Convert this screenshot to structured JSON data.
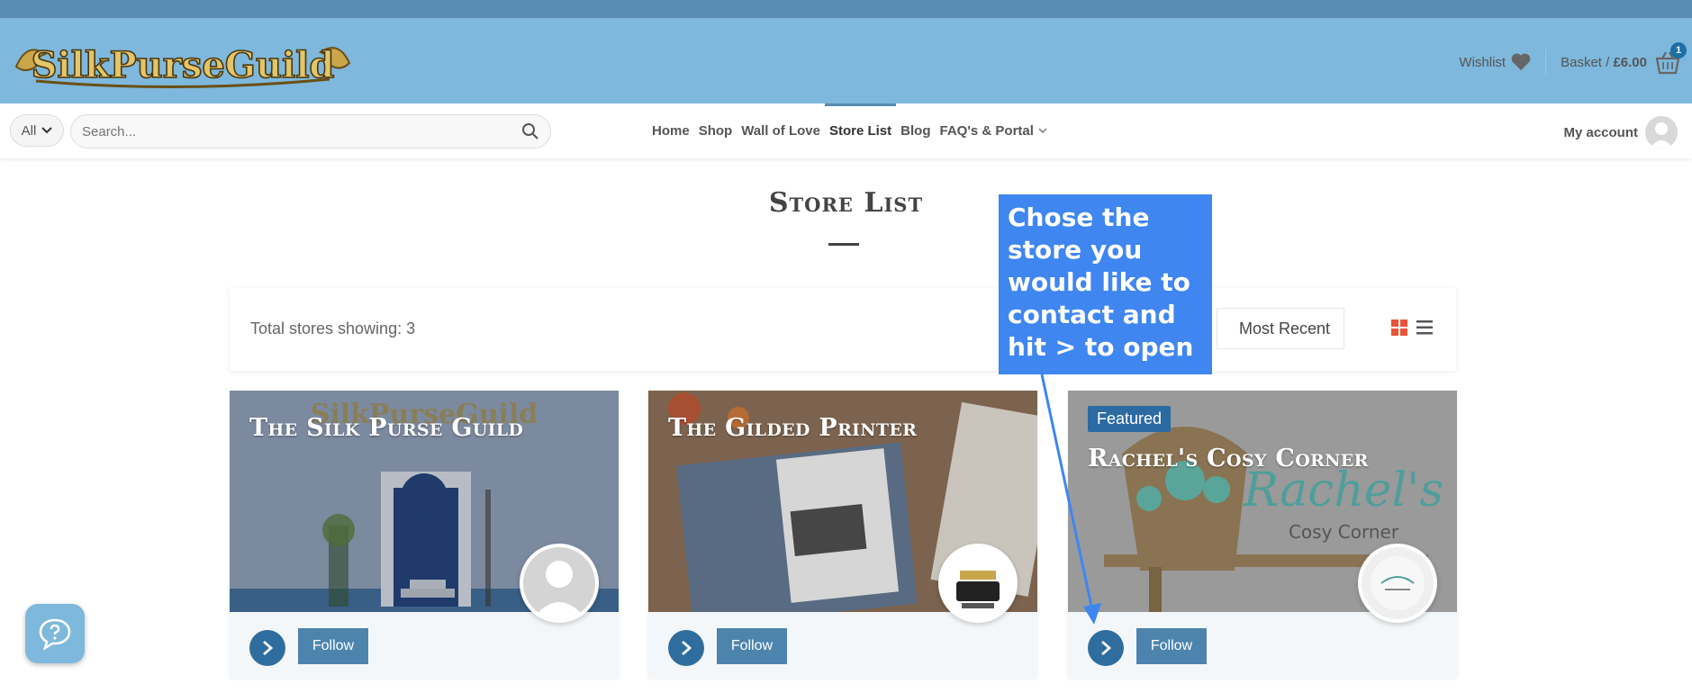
{
  "header": {
    "logo_text": "SilkPurseGuild",
    "wishlist_label": "Wishlist",
    "basket_label": "Basket / ",
    "basket_amount": "£6.00",
    "basket_count": "1"
  },
  "search": {
    "category": "All",
    "placeholder": "Search..."
  },
  "nav": {
    "items": [
      {
        "label": "Home"
      },
      {
        "label": "Shop"
      },
      {
        "label": "Wall of Love"
      },
      {
        "label": "Store List"
      },
      {
        "label": "Blog"
      },
      {
        "label": "FAQ's & Portal"
      }
    ],
    "account_label": "My account"
  },
  "page": {
    "title": "Store List",
    "total_stores": "Total stores showing: 3",
    "sort_value": "Most Recent"
  },
  "stores": [
    {
      "name": "The Silk Purse Guild",
      "follow": "Follow"
    },
    {
      "name": "The Gilded Printer",
      "follow": "Follow"
    },
    {
      "name": "Rachel's Cosy Corner",
      "follow": "Follow",
      "badge": "Featured",
      "banner_text": "Rachel's",
      "banner_subtext": "Cosy Corner"
    }
  ],
  "callout": {
    "text": "Chose the store you would like to contact and hit > to open"
  },
  "colors": {
    "header_bg": "#7eb8dc",
    "topbar_bg": "#5a8db3",
    "button_blue": "#4d84ae",
    "callout_blue": "#3f86f0",
    "featured_badge": "#2c6aa3"
  }
}
